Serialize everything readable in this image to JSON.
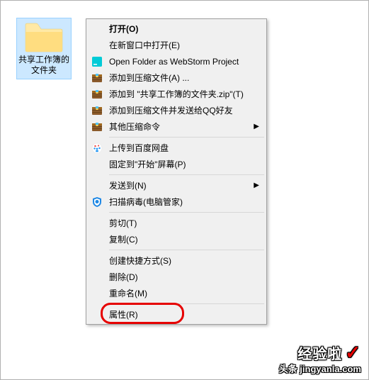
{
  "folder": {
    "label": "共享工作簿的文件夹"
  },
  "menu": {
    "items": [
      {
        "label": "打开(O)",
        "bold": true
      },
      {
        "label": "在新窗口中打开(E)"
      },
      {
        "label": "Open Folder as WebStorm Project",
        "icon": "webstorm"
      },
      {
        "label": "添加到压缩文件(A) ...",
        "icon": "archive"
      },
      {
        "label": "添加到 \"共享工作簿的文件夹.zip\"(T)",
        "icon": "archive-zip"
      },
      {
        "label": "添加到压缩文件并发送给QQ好友",
        "icon": "archive-qq"
      },
      {
        "label": "其他压缩命令",
        "icon": "archive-other",
        "arrow": true
      },
      {
        "separator": true
      },
      {
        "label": "上传到百度网盘",
        "icon": "baidu"
      },
      {
        "label": "固定到\"开始\"屏幕(P)"
      },
      {
        "separator": true
      },
      {
        "label": "发送到(N)",
        "arrow": true
      },
      {
        "label": "扫描病毒(电脑管家)",
        "icon": "qq-guard"
      },
      {
        "separator": true
      },
      {
        "label": "剪切(T)"
      },
      {
        "label": "复制(C)"
      },
      {
        "separator": true
      },
      {
        "label": "创建快捷方式(S)"
      },
      {
        "label": "删除(D)"
      },
      {
        "label": "重命名(M)"
      },
      {
        "separator": true
      },
      {
        "label": "属性(R)",
        "highlight": true
      }
    ]
  },
  "watermark": {
    "line1": "经验啦",
    "line2": "头条 jingyanla.com"
  }
}
